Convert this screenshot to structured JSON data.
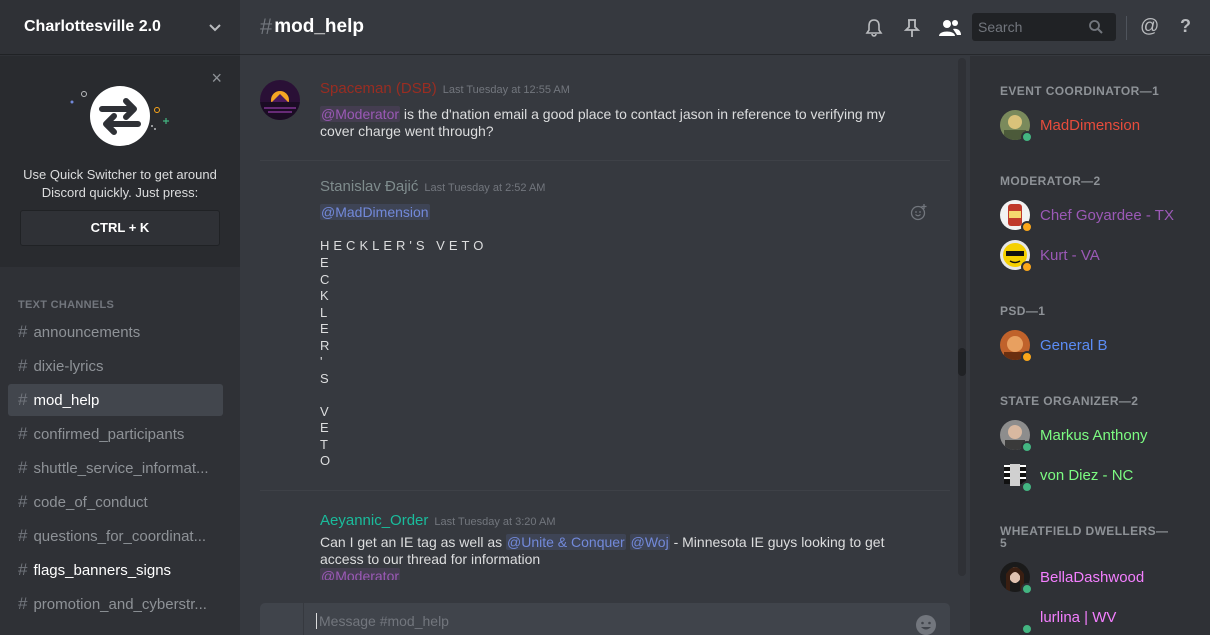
{
  "server": {
    "name": "Charlottesville 2.0"
  },
  "quick_switcher": {
    "text": "Use Quick Switcher to get around Discord quickly. Just press:",
    "shortcut": "CTRL + K",
    "close": "×"
  },
  "channels": {
    "category": "TEXT CHANNELS",
    "items": [
      {
        "name": "announcements",
        "state": "normal"
      },
      {
        "name": "dixie-lyrics",
        "state": "normal"
      },
      {
        "name": "mod_help",
        "state": "active"
      },
      {
        "name": "confirmed_participants",
        "state": "normal"
      },
      {
        "name": "shuttle_service_informat...",
        "state": "normal"
      },
      {
        "name": "code_of_conduct",
        "state": "normal"
      },
      {
        "name": "questions_for_coordinat...",
        "state": "normal"
      },
      {
        "name": "flags_banners_signs",
        "state": "unread"
      },
      {
        "name": "promotion_and_cyberstr...",
        "state": "normal"
      }
    ]
  },
  "header": {
    "hash": "#",
    "channel": "mod_help",
    "search_placeholder": "Search",
    "at": "@",
    "help": "?"
  },
  "messages": [
    {
      "author": "Spaceman (DSB)",
      "color": "#992d22",
      "time": "Last Tuesday at 12:55 AM",
      "mention": "@Moderator",
      "text": " is the d'nation email a good place to contact jason in reference to verifying my cover charge went through?"
    },
    {
      "author": "Stanislav Đajić",
      "color": "#7f8c8d",
      "time": "Last Tuesday at 2:52 AM",
      "mention": "@MadDimension",
      "heading": "HECKLER'S VETO",
      "vertical": [
        "E",
        "C",
        "K",
        "L",
        "E",
        "R",
        "'",
        "S",
        "",
        "V",
        "E",
        "T",
        "O"
      ]
    },
    {
      "author": "Aeyannic_Order",
      "color": "#1abc9c",
      "time": "Last Tuesday at 3:20 AM",
      "text_a": "Can I get an IE tag as well as ",
      "mention_a": "@Unite & Conquer",
      "mention_b": "@Woj",
      "text_b": " - Minnesota IE guys looking to get access to our thread for information",
      "mention_c": "@Moderator"
    }
  ],
  "composer": {
    "placeholder": "Message #mod_help"
  },
  "members": {
    "groups": [
      {
        "role": "EVENT COORDINATOR—1",
        "members": [
          {
            "name": "MadDimension",
            "color": "#e74c3c",
            "status": "#43b581"
          }
        ]
      },
      {
        "role": "MODERATOR—2",
        "members": [
          {
            "name": "Chef Goyardee - TX",
            "color": "#9b59b6",
            "status": "#faa61a"
          },
          {
            "name": "Kurt - VA",
            "color": "#9b59b6",
            "status": "#faa61a"
          }
        ]
      },
      {
        "role": "PSD—1",
        "members": [
          {
            "name": "General B",
            "color": "#5b8cf5",
            "status": "#faa61a"
          }
        ]
      },
      {
        "role": "STATE ORGANIZER—2",
        "members": [
          {
            "name": "Markus Anthony",
            "color": "#7cfc82",
            "status": "#43b581"
          },
          {
            "name": "von Diez - NC",
            "color": "#7cfc82",
            "status": "#43b581"
          }
        ]
      },
      {
        "role": "WHEATFIELD DWELLERS—5",
        "members": [
          {
            "name": "BellaDashwood",
            "color": "#f47fff",
            "status": "#43b581"
          },
          {
            "name": "lurlina | WV",
            "color": "#f47fff",
            "status": "#43b581"
          }
        ]
      }
    ]
  }
}
